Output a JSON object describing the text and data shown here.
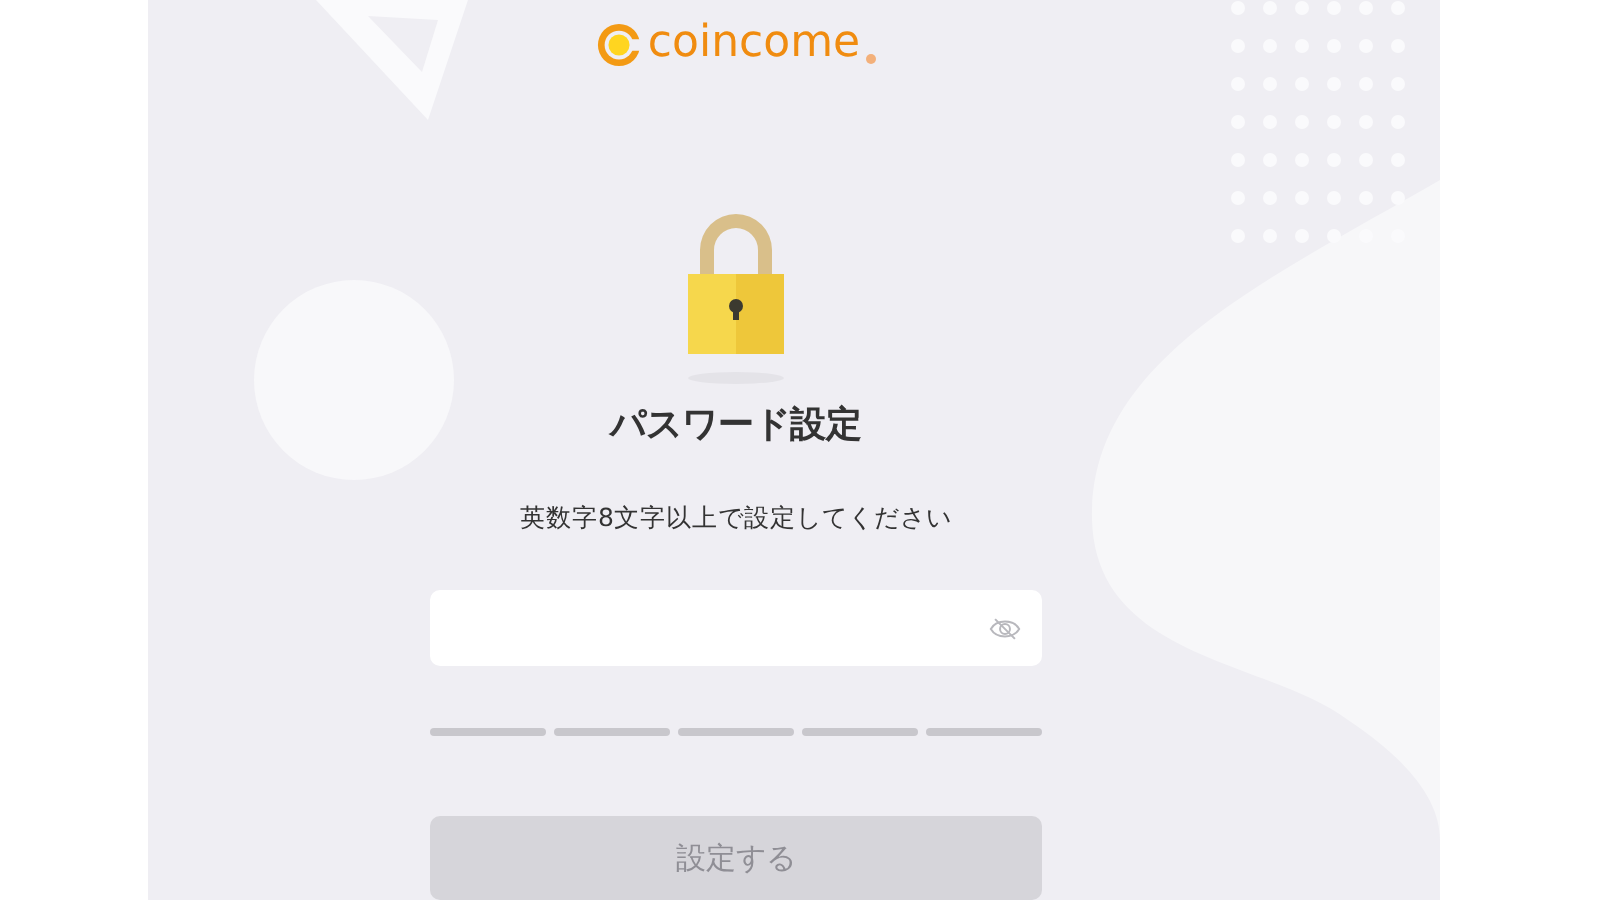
{
  "logo": {
    "text": "coincome"
  },
  "title": "パスワード設定",
  "hint": "英数字8文字以上で設定してください",
  "password_field": {
    "masked": true
  },
  "strength_meter": [
    {
      "filled": false
    },
    {
      "filled": false
    },
    {
      "filled": false
    },
    {
      "filled": false
    },
    {
      "filled": false
    }
  ],
  "submit_button": {
    "label": "設定する",
    "disabled": true
  }
}
